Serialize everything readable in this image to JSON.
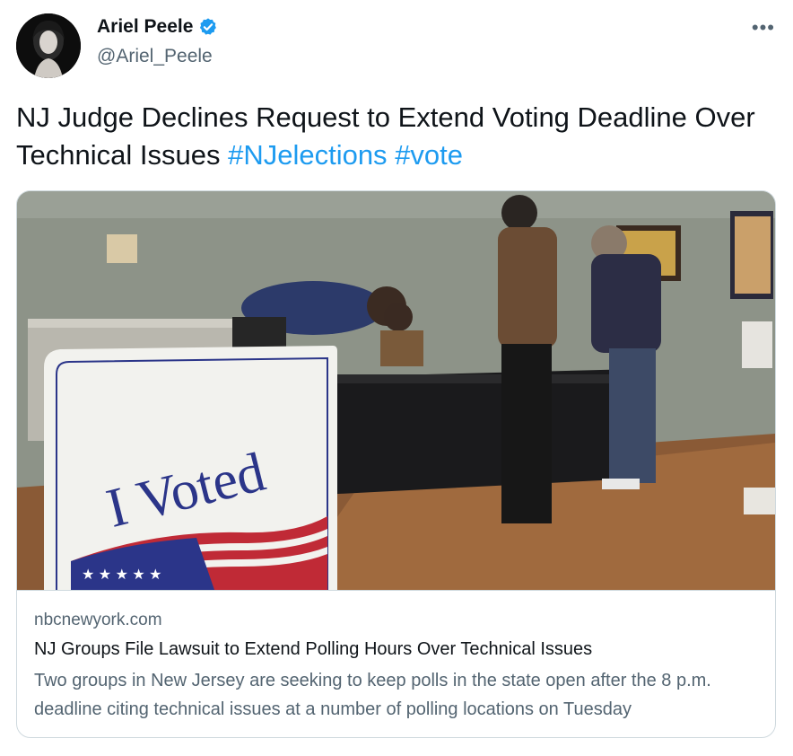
{
  "author": {
    "name": "Ariel Peele",
    "handle": "@Ariel_Peele",
    "verified": true,
    "avatar_icon": "profile-photo"
  },
  "more_icon": "more-horizontal-icon",
  "more_label": "•••",
  "tweet": {
    "text": "NJ Judge Declines Request to Extend Voting Deadline Over Technical Issues",
    "hashtags": [
      "#NJelections",
      "#vote"
    ]
  },
  "card": {
    "image_sign_text": "I Voted",
    "domain": "nbcnewyork.com",
    "title": "NJ Groups File Lawsuit to Extend Polling Hours Over Technical Issues",
    "description": "Two groups in New Jersey are seeking to keep polls in the state open after the 8 p.m. deadline citing technical issues at a number of polling locations on Tuesday"
  },
  "colors": {
    "link": "#1d9bf0",
    "secondary_text": "#536471",
    "primary_text": "#0f1419",
    "border": "#cfd9de",
    "verified_badge": "#1d9bf0"
  }
}
